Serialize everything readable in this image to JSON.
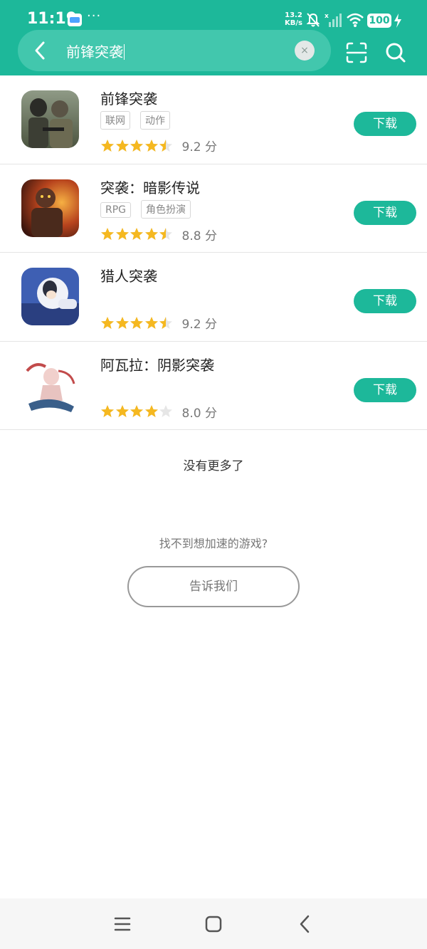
{
  "status_bar": {
    "time": "11:19",
    "dots": "···",
    "net_speed_value": "13.2",
    "net_speed_unit": "KB/s",
    "battery": "100"
  },
  "search": {
    "query": "前锋突袭",
    "clear_label": "×"
  },
  "results": [
    {
      "name": "前锋突袭",
      "tags": [
        "联网",
        "动作"
      ],
      "rating": 4.5,
      "score": "9.2 分",
      "download_label": "下载"
    },
    {
      "name": "突袭：暗影传说",
      "tags": [
        "RPG",
        "角色扮演"
      ],
      "rating": 4.5,
      "score": "8.8 分",
      "download_label": "下载"
    },
    {
      "name": "猎人突袭",
      "tags": [],
      "rating": 4.5,
      "score": "9.2 分",
      "download_label": "下载"
    },
    {
      "name": "阿瓦拉：阴影突袭",
      "tags": [],
      "rating": 4.0,
      "score": "8.0 分",
      "download_label": "下载"
    }
  ],
  "footer": {
    "no_more": "没有更多了",
    "cant_find": "找不到想加速的游戏?",
    "tell_us": "告诉我们"
  },
  "colors": {
    "accent": "#1db89a",
    "star": "#f5b820",
    "star_empty": "#e6e6e6"
  }
}
